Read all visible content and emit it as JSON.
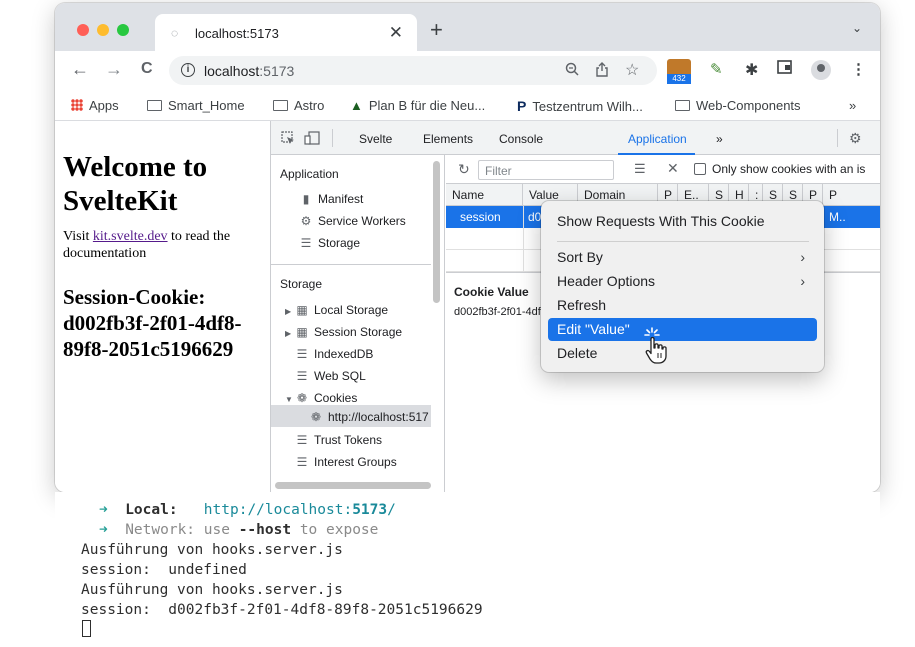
{
  "browser": {
    "tab": {
      "title": "localhost:5173",
      "close": "✕"
    },
    "new_tab": "+",
    "tab_menu": "⌄",
    "nav": {
      "back": "←",
      "forward": "→",
      "reload": "C"
    },
    "address": {
      "host": "localhost",
      "port": ":5173",
      "info": "i"
    },
    "omnibox_icons": {
      "zoom": "🔍",
      "share": "⇪",
      "star": "☆"
    },
    "extensions": {
      "badge_count": "432",
      "puzzle": "✱",
      "menu": "⋮"
    },
    "bookmarks": [
      {
        "label": "Apps",
        "icon": "apps-icon"
      },
      {
        "label": "Smart_Home",
        "icon": "folder-icon"
      },
      {
        "label": "Astro",
        "icon": "folder-icon"
      },
      {
        "label": "Plan B für die Neu...",
        "icon": "hat-icon"
      },
      {
        "label": "Testzentrum Wilh...",
        "icon": "p-icon",
        "glyph": "P"
      },
      {
        "label": "Web-Components",
        "icon": "folder-icon"
      }
    ],
    "bookmarks_more": "»"
  },
  "page": {
    "title": "Welcome to SvelteKit",
    "visit_prefix": "Visit ",
    "link": "kit.svelte.dev",
    "visit_suffix": " to read the documentation",
    "session_heading": "Session-Cookie: d002fb3f-2f01-4df8-89f8-2051c5196629"
  },
  "devtools": {
    "tabs": [
      "Svelte",
      "Elements",
      "Console",
      "Application"
    ],
    "active_tab": "Application",
    "more_tabs": "»",
    "sidebar": {
      "application_head": "Application",
      "application_items": [
        "Manifest",
        "Service Workers",
        "Storage"
      ],
      "storage_head": "Storage",
      "storage_items": [
        "Local Storage",
        "Session Storage",
        "IndexedDB",
        "Web SQL",
        "Cookies",
        "http://localhost:5173",
        "Trust Tokens",
        "Interest Groups"
      ]
    },
    "filter_placeholder": "Filter",
    "only_cookies_label": "Only show cookies with an is",
    "columns": [
      "Name",
      "Value",
      "Domain",
      "P",
      "E..",
      "S",
      "H",
      ":",
      "S",
      "S",
      "P",
      "P"
    ],
    "selected_row": {
      "name": "session",
      "value": "d0",
      "last": "M.."
    },
    "cookie_value_title": "Cookie Value",
    "cookie_value": "d002fb3f-2f01-4df8-89f8-2051c5196629"
  },
  "context_menu": {
    "items": [
      {
        "label": "Show Requests With This Cookie",
        "submenu": false
      },
      {
        "label": "Sort By",
        "submenu": true
      },
      {
        "label": "Header Options",
        "submenu": true
      },
      {
        "label": "Refresh",
        "submenu": false
      },
      {
        "label": "Edit \"Value\"",
        "submenu": false,
        "highlighted": true
      },
      {
        "label": "Delete",
        "submenu": false
      }
    ],
    "submenu_arrow": "›"
  },
  "terminal": {
    "lines": [
      {
        "arrow": "➜",
        "label": "Local:",
        "value_prefix": "http://localhost:",
        "value_port": "5173",
        "value_suffix": "/"
      },
      {
        "arrow": "➜",
        "label": "Network:",
        "text_pre": "use ",
        "text_bold": "--host",
        "text_post": " to expose"
      }
    ],
    "log": [
      "Ausführung von hooks.server.js",
      "session:  undefined",
      "Ausführung von hooks.server.js",
      "session:  d002fb3f-2f01-4df8-89f8-2051c5196629"
    ]
  },
  "colors": {
    "accent": "#1a73e8",
    "terminal_arrow": "#2aa198",
    "terminal_url": "#1a8a9a",
    "traffic_red": "#ff5f57",
    "traffic_yellow": "#febc2e",
    "traffic_green": "#28c840"
  }
}
